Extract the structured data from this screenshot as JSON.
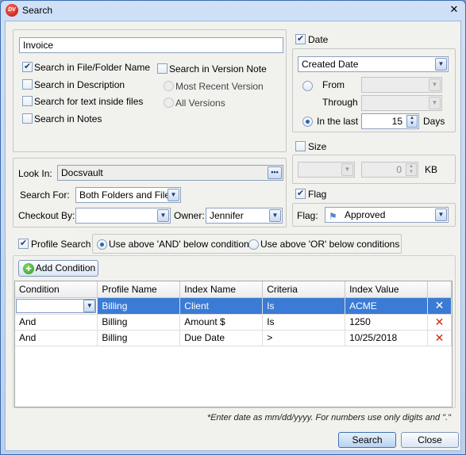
{
  "window": {
    "title": "Search",
    "app_icon_text": "DV"
  },
  "search": {
    "keyword": "Invoice",
    "options": {
      "file_folder_name": {
        "label": "Search in File/Folder Name",
        "checked": true
      },
      "description": {
        "label": "Search in Description",
        "checked": false
      },
      "text_inside_files": {
        "label": "Search for text inside files",
        "checked": false
      },
      "notes": {
        "label": "Search in Notes",
        "checked": false
      },
      "version_note": {
        "label": "Search in Version Note",
        "checked": false
      },
      "most_recent_version": {
        "label": "Most Recent Version"
      },
      "all_versions": {
        "label": "All Versions"
      }
    }
  },
  "location": {
    "look_in_label": "Look In:",
    "look_in_value": "Docsvault",
    "search_for_label": "Search For:",
    "search_for_value": "Both Folders and Files",
    "checkout_by_label": "Checkout By:",
    "checkout_by_value": "",
    "owner_label": "Owner:",
    "owner_value": "Jennifer"
  },
  "date": {
    "label": "Date",
    "checked": true,
    "field_value": "Created Date",
    "from_label": "From",
    "through_label": "Through",
    "in_the_last_label": "In the last",
    "in_the_last_value": "15",
    "unit": "Days"
  },
  "size": {
    "label": "Size",
    "checked": false,
    "value": "0",
    "unit": "KB"
  },
  "flag": {
    "label": "Flag",
    "checked": true,
    "field_label": "Flag:",
    "value": "Approved"
  },
  "profile": {
    "label": "Profile Search",
    "checked": true,
    "and_option": "Use above 'AND' below conditions",
    "or_option": "Use above 'OR' below conditions",
    "add_condition_label": "Add Condition",
    "columns": [
      "Condition",
      "Profile Name",
      "Index Name",
      "Criteria",
      "Index Value"
    ],
    "rows": [
      {
        "condition": "",
        "profile": "Billing",
        "index": "Client",
        "criteria": "Is",
        "value": "ACME"
      },
      {
        "condition": "And",
        "profile": "Billing",
        "index": "Amount $",
        "criteria": "Is",
        "value": "1250"
      },
      {
        "condition": "And",
        "profile": "Billing",
        "index": "Due Date",
        "criteria": ">",
        "value": "10/25/2018"
      }
    ]
  },
  "footer": {
    "note": "*Enter date as mm/dd/yyyy. For numbers use only digits and \".\"",
    "search_button": "Search",
    "close_button": "Close"
  },
  "icons": {
    "delete": "red-x",
    "add": "green-plus",
    "flag": "flag"
  }
}
